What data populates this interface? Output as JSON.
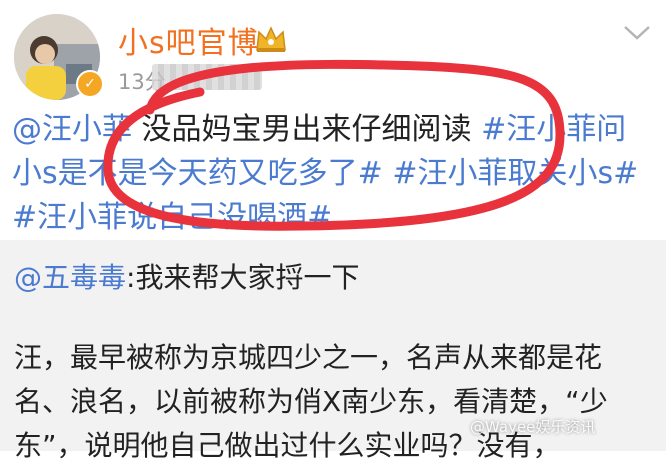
{
  "post": {
    "author": "小s吧官博",
    "time": "13分",
    "mention": "@汪小菲",
    "text_plain": " 没品妈宝男出来仔细阅读 ",
    "tag1": "#汪小菲问小s是不是今天药又吃多了#",
    "tag2": "#汪小菲取关小s#",
    "tag3": "#汪小菲说自己没喝酒#"
  },
  "quote": {
    "mention": "@五毒毒",
    "line1": ":我来帮大家捋一下",
    "body": "汪，最早被称为京城四少之一，名声从来都是花名、浪名，以前被称为俏X南少东，看清楚，“少东”，说明他自己做出过什么实业吗？没有，"
  },
  "watermark": "@Wayee娱乐资讯",
  "icons": {
    "crown": "crown-icon",
    "verified": "verified-badge-icon",
    "more": "chevron-down-icon"
  },
  "colors": {
    "username": "#f3701f",
    "link": "#4a7bd0",
    "highlight_circle": "#e8323c"
  }
}
